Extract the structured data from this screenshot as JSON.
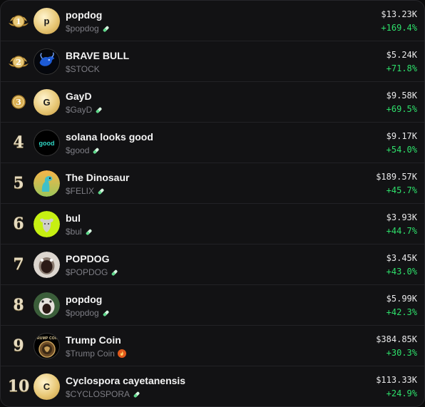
{
  "tokens": [
    {
      "rank": "1",
      "name": "popdog",
      "ticker": "$popdog",
      "badge": "pill",
      "mcap": "$13.23K",
      "change": "+169.4%",
      "avatar_letter": "p"
    },
    {
      "rank": "2",
      "name": "BRAVE BULL",
      "ticker": "$STOCK",
      "badge": "",
      "mcap": "$5.24K",
      "change": "+71.8%",
      "avatar_letter": ""
    },
    {
      "rank": "3",
      "name": "GayD",
      "ticker": "$GayD",
      "badge": "pill",
      "mcap": "$9.58K",
      "change": "+69.5%",
      "avatar_letter": "G"
    },
    {
      "rank": "4",
      "name": "solana looks good",
      "ticker": "$good",
      "badge": "pill",
      "mcap": "$9.17K",
      "change": "+54.0%",
      "avatar_letter": "good"
    },
    {
      "rank": "5",
      "name": "The Dinosaur",
      "ticker": "$FELIX",
      "badge": "pill",
      "mcap": "$189.57K",
      "change": "+45.7%",
      "avatar_letter": ""
    },
    {
      "rank": "6",
      "name": "bul",
      "ticker": "$bul",
      "badge": "pill",
      "mcap": "$3.93K",
      "change": "+44.7%",
      "avatar_letter": ""
    },
    {
      "rank": "7",
      "name": "POPDOG",
      "ticker": "$POPDOG",
      "badge": "pill",
      "mcap": "$3.45K",
      "change": "+43.0%",
      "avatar_letter": ""
    },
    {
      "rank": "8",
      "name": "popdog",
      "ticker": "$popdog",
      "badge": "pill",
      "mcap": "$5.99K",
      "change": "+42.3%",
      "avatar_letter": ""
    },
    {
      "rank": "9",
      "name": "Trump Coin",
      "ticker": "$Trump Coin",
      "badge": "fire",
      "mcap": "$384.85K",
      "change": "+30.3%",
      "avatar_letter": "TRUMP COIN"
    },
    {
      "rank": "10",
      "name": "Cyclospora cayetanensis",
      "ticker": "$CYCLOSPORA",
      "badge": "pill",
      "mcap": "$113.33K",
      "change": "+24.9%",
      "avatar_letter": "C"
    }
  ],
  "colors": {
    "positive": "#2ee06b",
    "background": "#121214",
    "gold": "#e8c877"
  }
}
